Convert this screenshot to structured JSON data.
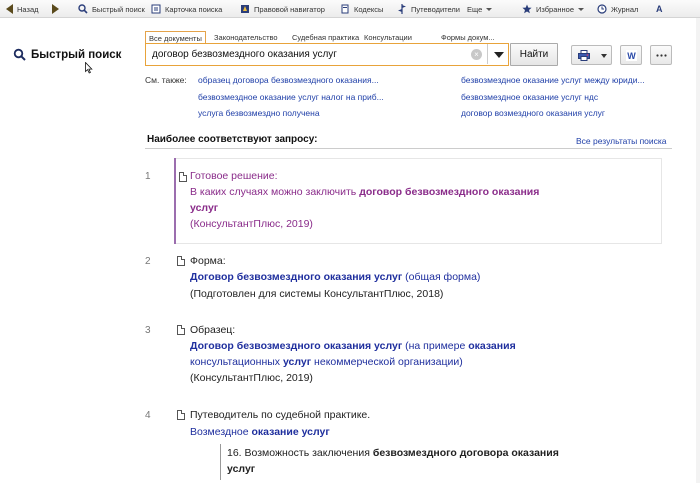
{
  "toolbar": {
    "back": "Назад",
    "quick_search": "Быстрый поиск",
    "search_card": "Карточка поиска",
    "legal_navigator": "Правовой навигатор",
    "codes": "Кодексы",
    "guides": "Путеводители",
    "more": "Еще",
    "favorites": "Избранное",
    "journal": "Журнал",
    "text_size": "А"
  },
  "left": {
    "title": "Быстрый поиск"
  },
  "tabs": [
    "Все документы",
    "Законодательство",
    "Судебная практика",
    "Консультации",
    "Формы докум..."
  ],
  "search": {
    "query": "договор безвозмездного оказания услуг",
    "clear": "×",
    "find_label": "Найти"
  },
  "see_also": {
    "label": "См. также:",
    "links": [
      "образец договора безвозмездного оказания...",
      "безвозмездное оказание услуг между юриди...",
      "безвозмездное оказание услуг налог на приб...",
      "безвозмездное оказание услуг ндс",
      "услуга безвозмездно получена",
      "договор возмездного оказания услуг"
    ]
  },
  "results_header": {
    "title": "Наиболее соответствуют запросу:",
    "all_results": "Все результаты поиска"
  },
  "results": [
    {
      "num": "1",
      "kind": "Готовое решение:",
      "title_prefix": "В каких случаях можно заключить ",
      "title_bold": "договор безвозмездного оказания",
      "title_line2_bold": "услуг",
      "source": "(КонсультантПлюс, 2019)"
    },
    {
      "num": "2",
      "kind": "Форма:",
      "title_bold": "Договор безвозмездного оказания услуг",
      "title_suffix": " (общая форма)",
      "source": "(Подготовлен для системы КонсультантПлюс, 2018)"
    },
    {
      "num": "3",
      "kind": "Образец:",
      "title_bold": "Договор безвозмездного оказания услуг",
      "title_suffix": " (на примере ",
      "title_bold2": "оказания",
      "line2_a": "консультационных ",
      "line2_bold": "услуг",
      "line2_b": " некоммерческой организации)",
      "source": "(КонсультантПлюс, 2019)"
    },
    {
      "num": "4",
      "kind": "Путеводитель по судебной практике.",
      "title_prefix": "Возмездное ",
      "title_bold": "оказание услуг",
      "quote_prefix": "16. Возможность заключения ",
      "quote_bold": "безвозмездного договора оказания",
      "quote_line2_bold": "услуг"
    }
  ]
}
